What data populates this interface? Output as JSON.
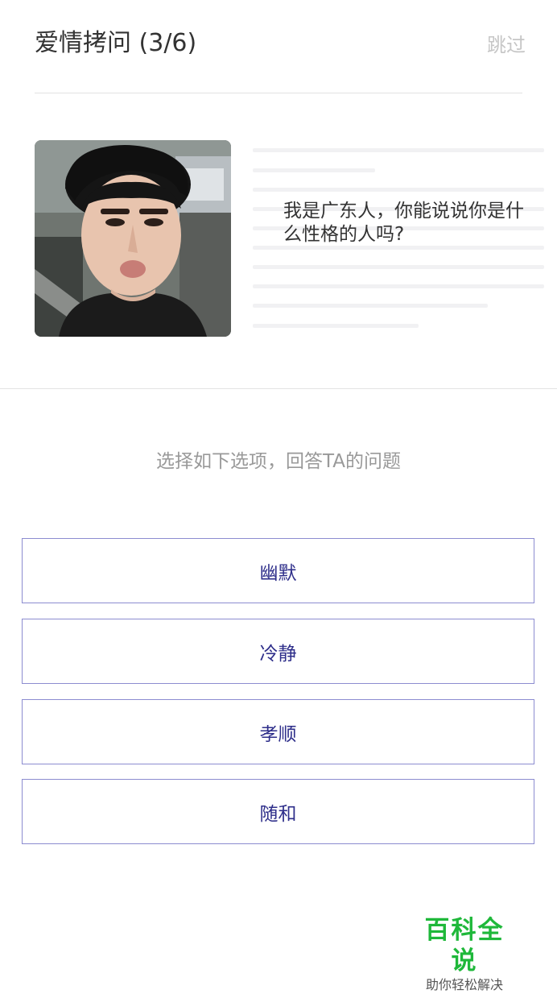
{
  "header": {
    "title": "爱情拷问 (3/6)",
    "skip_label": "跳过"
  },
  "profile": {
    "avatar_icon": "person-photo",
    "question": "我是广东人，你能说说你是什么性格的人吗?"
  },
  "answer": {
    "prompt": "选择如下选项，回答TA的问题",
    "options": [
      {
        "label": "幽默"
      },
      {
        "label": "冷静"
      },
      {
        "label": "孝顺"
      },
      {
        "label": "随和"
      }
    ]
  },
  "watermark": {
    "brand": "百科全说",
    "tagline": "助你轻松解决"
  },
  "colors": {
    "option_border": "#8c8cd0",
    "option_text": "#2e2e8a",
    "watermark_green": "#1fb83a",
    "muted_text": "#999999",
    "skip_text": "#c6c6c6"
  }
}
